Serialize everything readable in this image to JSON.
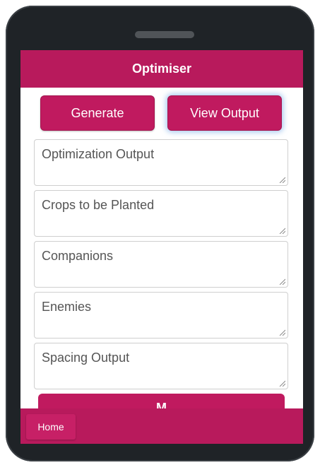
{
  "app": {
    "title": "Optimiser"
  },
  "toolbar": {
    "generate_label": "Generate",
    "view_output_label": "View Output"
  },
  "fields": [
    {
      "label": "Optimization Output"
    },
    {
      "label": "Crops to be Planted"
    },
    {
      "label": "Companions"
    },
    {
      "label": "Enemies"
    },
    {
      "label": "Spacing Output"
    }
  ],
  "more_button": {
    "label": "M"
  },
  "footer": {
    "home_label": "Home"
  },
  "colors": {
    "accent": "#b81a5c",
    "phone_body": "#1f2327"
  }
}
